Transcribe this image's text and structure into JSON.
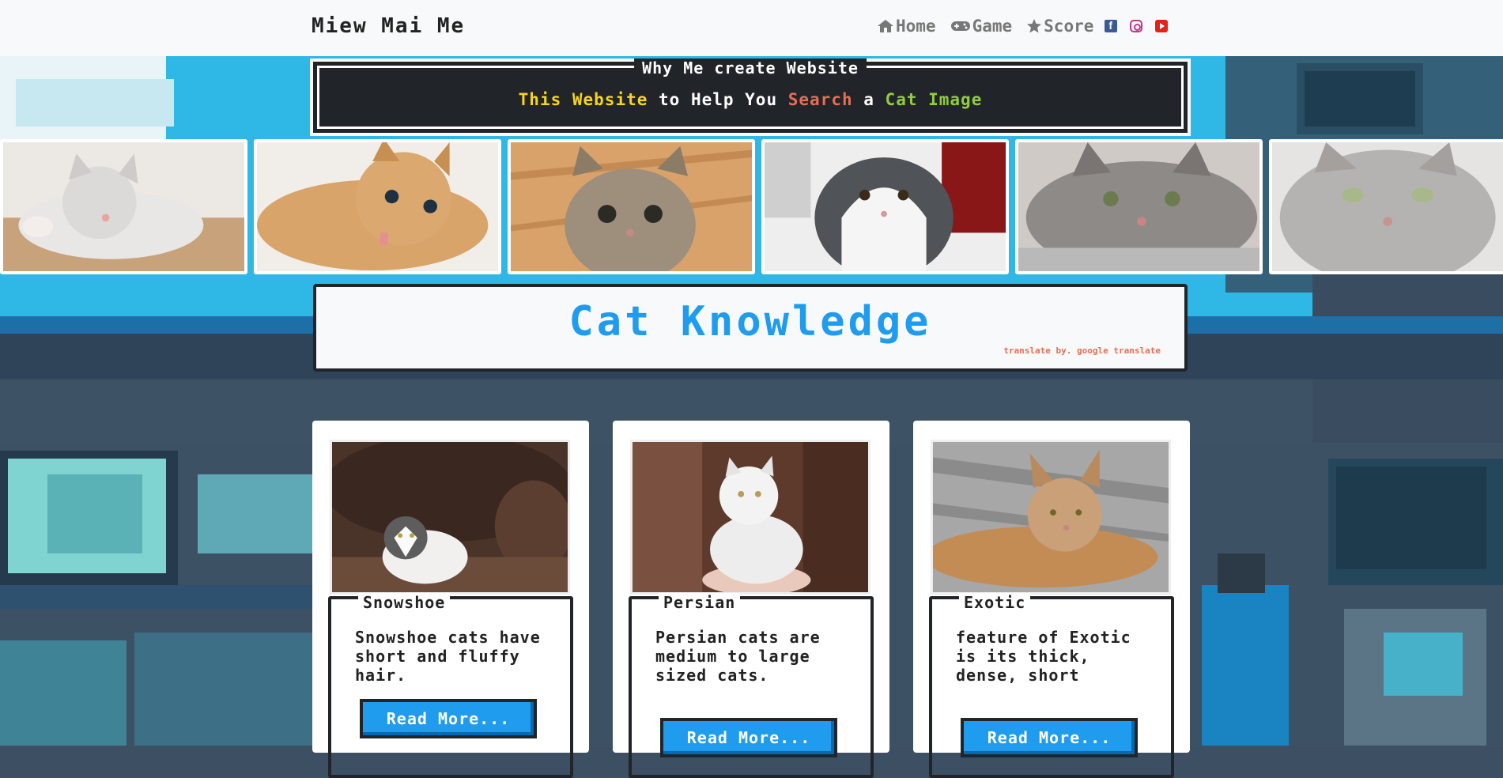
{
  "navbar": {
    "brand": "Miew Mai Me",
    "links": [
      {
        "label": "Home",
        "icon": "home-icon"
      },
      {
        "label": "Game",
        "icon": "gamepad-icon"
      },
      {
        "label": "Score",
        "icon": "star-icon"
      }
    ],
    "social": [
      "facebook-icon",
      "instagram-icon",
      "youtube-icon"
    ]
  },
  "why": {
    "title": "Why Me create Website",
    "parts": [
      {
        "text": "This Website",
        "color": "#f7d51d"
      },
      {
        "text": " to Help You ",
        "color": "#ffffff"
      },
      {
        "text": "Search",
        "color": "#e76e55"
      },
      {
        "text": " a ",
        "color": "#ffffff"
      },
      {
        "text": "Cat Image",
        "color": "#92cc41"
      }
    ]
  },
  "knowledge": {
    "title": "Cat Knowledge",
    "note": "translate by. google translate"
  },
  "cards": [
    {
      "title": "Snowshoe",
      "text": "Snowshoe cats have short and fluffy hair.",
      "button": "Read More..."
    },
    {
      "title": "Persian",
      "text": "Persian cats are medium to large sized cats.",
      "button": "Read More..."
    },
    {
      "title": "Exotic",
      "text": "feature of Exotic is its thick, dense, short",
      "button": "Read More..."
    }
  ],
  "colors": {
    "accent_blue": "#209cee",
    "dark": "#212529",
    "navbar_bg": "#f8f9fa",
    "yellow": "#f7d51d",
    "orange": "#e76e55",
    "green": "#92cc41"
  }
}
